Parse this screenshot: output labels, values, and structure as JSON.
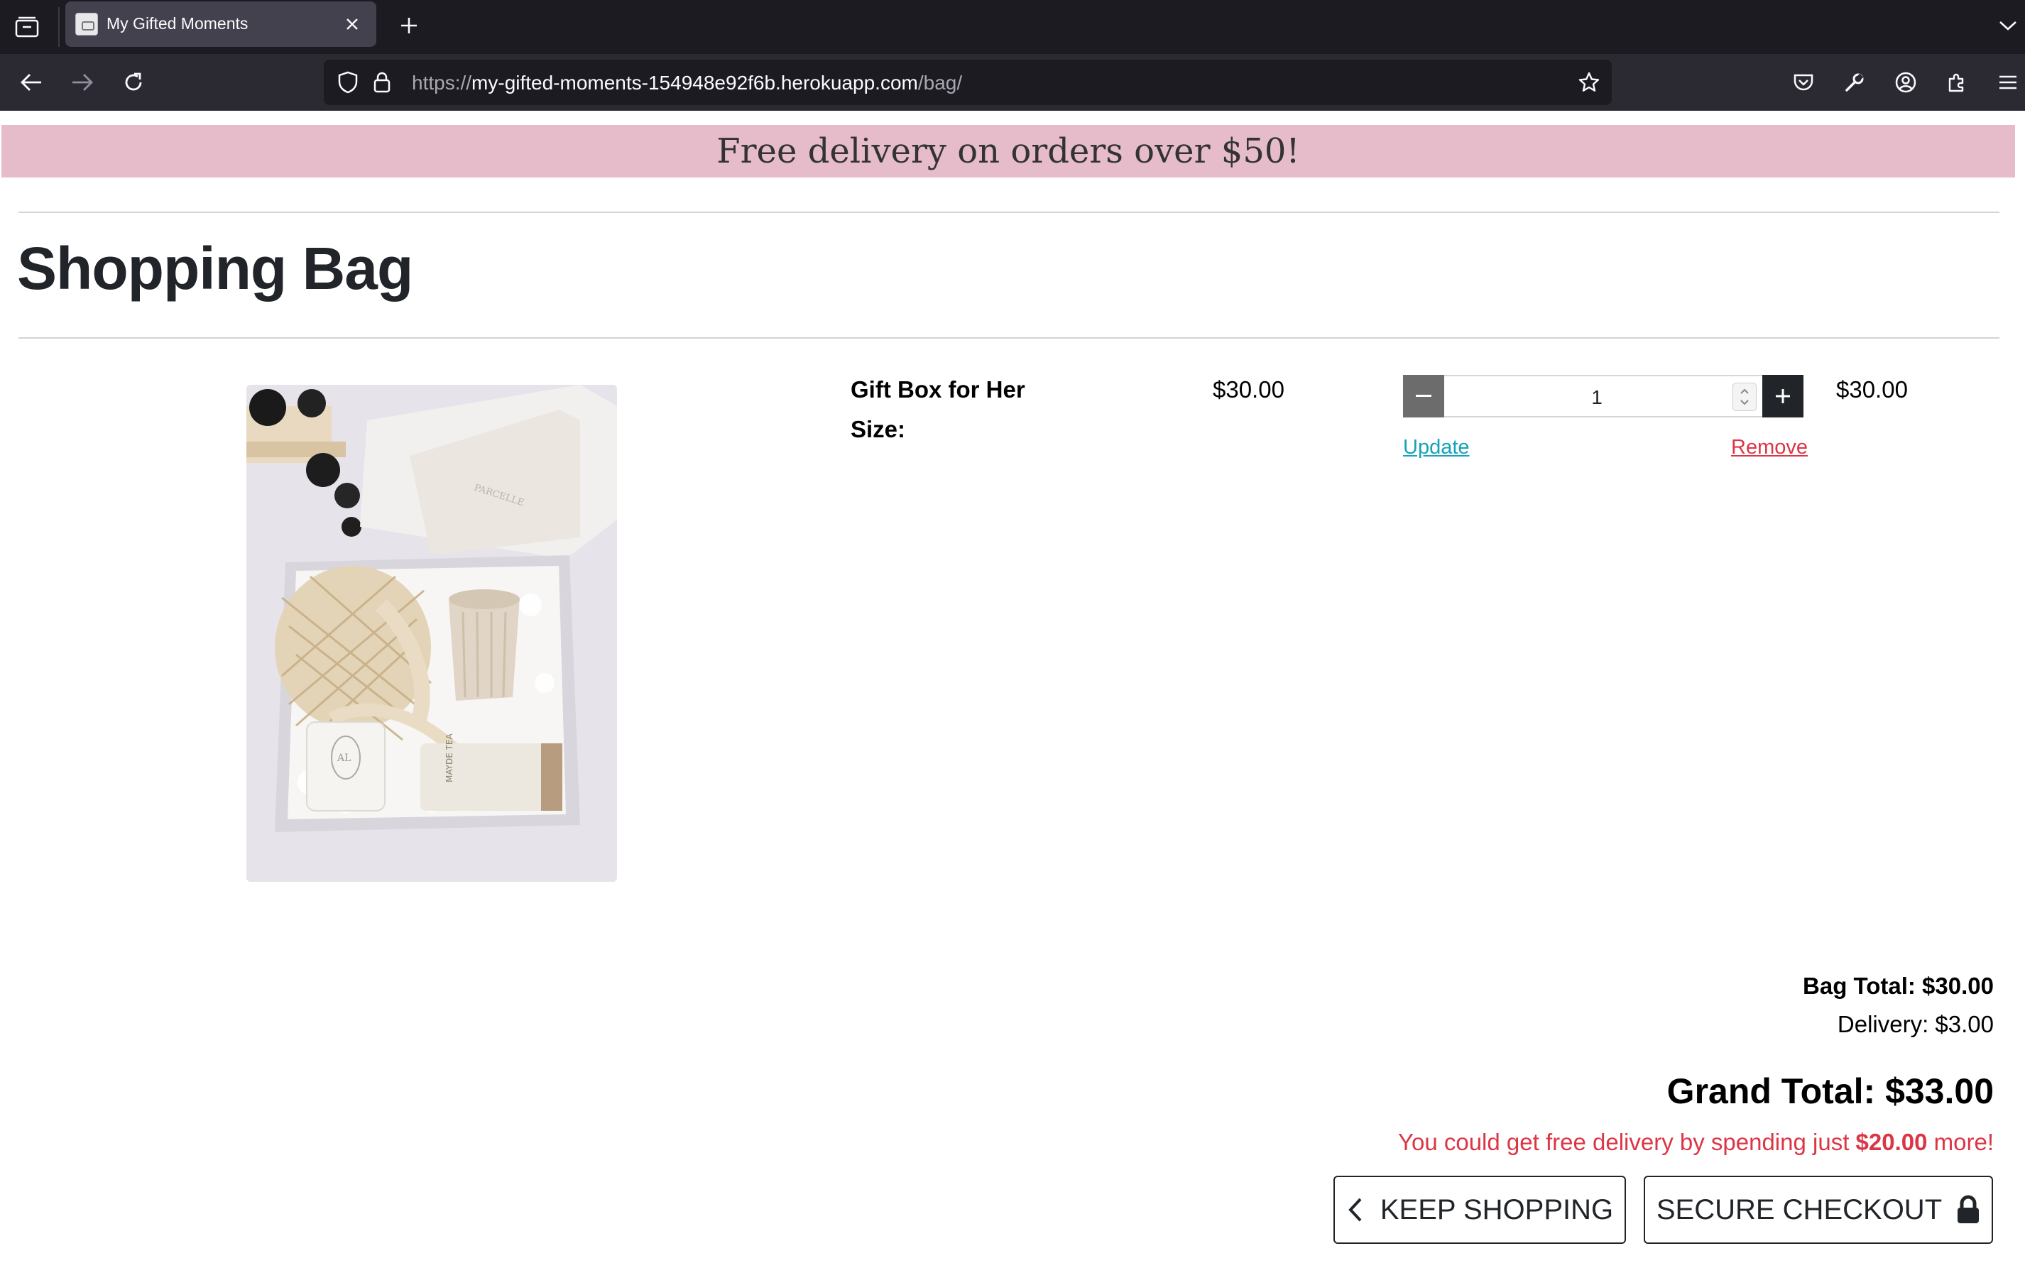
{
  "browser": {
    "tab_title": "My Gifted Moments",
    "url": {
      "scheme": "https://",
      "host": "my-gifted-moments-154948e92f6b.herokuapp.com",
      "path": "/bag/"
    }
  },
  "banner": {
    "text": "Free delivery on orders over $50!"
  },
  "page": {
    "title": "Shopping Bag"
  },
  "bag": {
    "items": [
      {
        "name": "Gift Box for Her",
        "size_label": "Size:",
        "price": "$30.00",
        "quantity": "1",
        "subtotal": "$30.00",
        "update_label": "Update",
        "remove_label": "Remove"
      }
    ]
  },
  "totals": {
    "bag_total": "Bag Total: $30.00",
    "delivery": "Delivery: $3.00",
    "grand_total": "Grand Total: $33.00",
    "free_delivery_prefix": "You could get free delivery by spending just ",
    "free_delivery_amount": "$20.00",
    "free_delivery_suffix": " more!"
  },
  "actions": {
    "keep_shopping": "KEEP SHOPPING",
    "secure_checkout": "SECURE CHECKOUT"
  },
  "colors": {
    "banner_bg": "#e6bccb",
    "update_link": "#17a2b8",
    "remove_link": "#dc3545",
    "warning_text": "#dc3545",
    "browser_chrome": "#1c1b22"
  }
}
